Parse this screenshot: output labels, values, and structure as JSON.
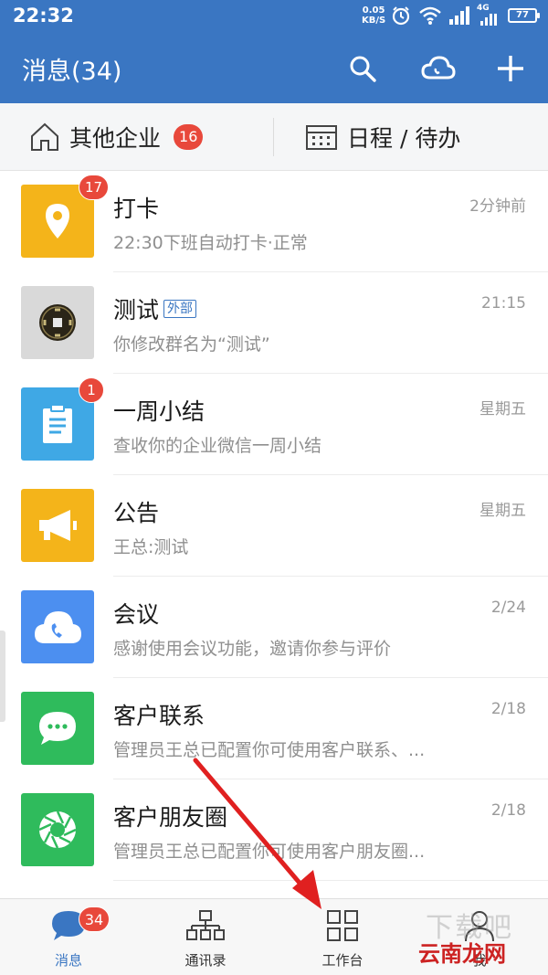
{
  "status_bar": {
    "time": "22:32",
    "net_speed_value": "0.05",
    "net_speed_unit": "KB/S",
    "network": "4G",
    "battery": "77"
  },
  "app_bar": {
    "title": "消息(34)",
    "actions": [
      "search-icon",
      "cloud-icon",
      "plus-icon"
    ]
  },
  "quick_bar": {
    "other_org_label": "其他企业",
    "other_org_badge": "16",
    "schedule_label": "日程 / 待办"
  },
  "conversations": [
    {
      "title": "打卡",
      "tag": "",
      "subtitle": "22:30下班自动打卡·正常",
      "time": "2分钟前",
      "badge": "17",
      "icon": "location-pin-icon",
      "color": "#f4b41a"
    },
    {
      "title": "测试",
      "tag": "外部",
      "subtitle": "你修改群名为“测试”",
      "time": "21:15",
      "badge": "",
      "icon": "coin-photo-icon",
      "color": "#d9d9d9"
    },
    {
      "title": "一周小结",
      "tag": "",
      "subtitle": "查收你的企业微信一周小结",
      "time": "星期五",
      "badge": "1",
      "icon": "clipboard-icon",
      "color": "#3fa8e5"
    },
    {
      "title": "公告",
      "tag": "",
      "subtitle": "王总:测试",
      "time": "星期五",
      "badge": "",
      "icon": "megaphone-icon",
      "color": "#f4b41a"
    },
    {
      "title": "会议",
      "tag": "",
      "subtitle": "感谢使用会议功能，邀请你参与评价",
      "time": "2/24",
      "badge": "",
      "icon": "cloud-phone-icon",
      "color": "#4c8ff0"
    },
    {
      "title": "客户联系",
      "tag": "",
      "subtitle": "管理员王总已配置你可使用客户联系、...",
      "time": "2/18",
      "badge": "",
      "icon": "chat-bubble-icon",
      "color": "#2fbb5c"
    },
    {
      "title": "客户朋友圈",
      "tag": "",
      "subtitle": "管理员王总已配置你可使用客户朋友圈...",
      "time": "2/18",
      "badge": "",
      "icon": "aperture-icon",
      "color": "#2fbb5c"
    }
  ],
  "tab_bar": {
    "tabs": [
      {
        "label": "消息",
        "badge": "34",
        "active": true
      },
      {
        "label": "通讯录",
        "badge": "",
        "active": false
      },
      {
        "label": "工作台",
        "badge": "",
        "active": false
      },
      {
        "label": "我",
        "badge": "",
        "active": false
      }
    ]
  },
  "watermark": {
    "brand": "云南龙网",
    "faint": "下载吧"
  },
  "colors": {
    "primary": "#3a76c2",
    "badge": "#e8483b",
    "arrow": "#e02020"
  }
}
